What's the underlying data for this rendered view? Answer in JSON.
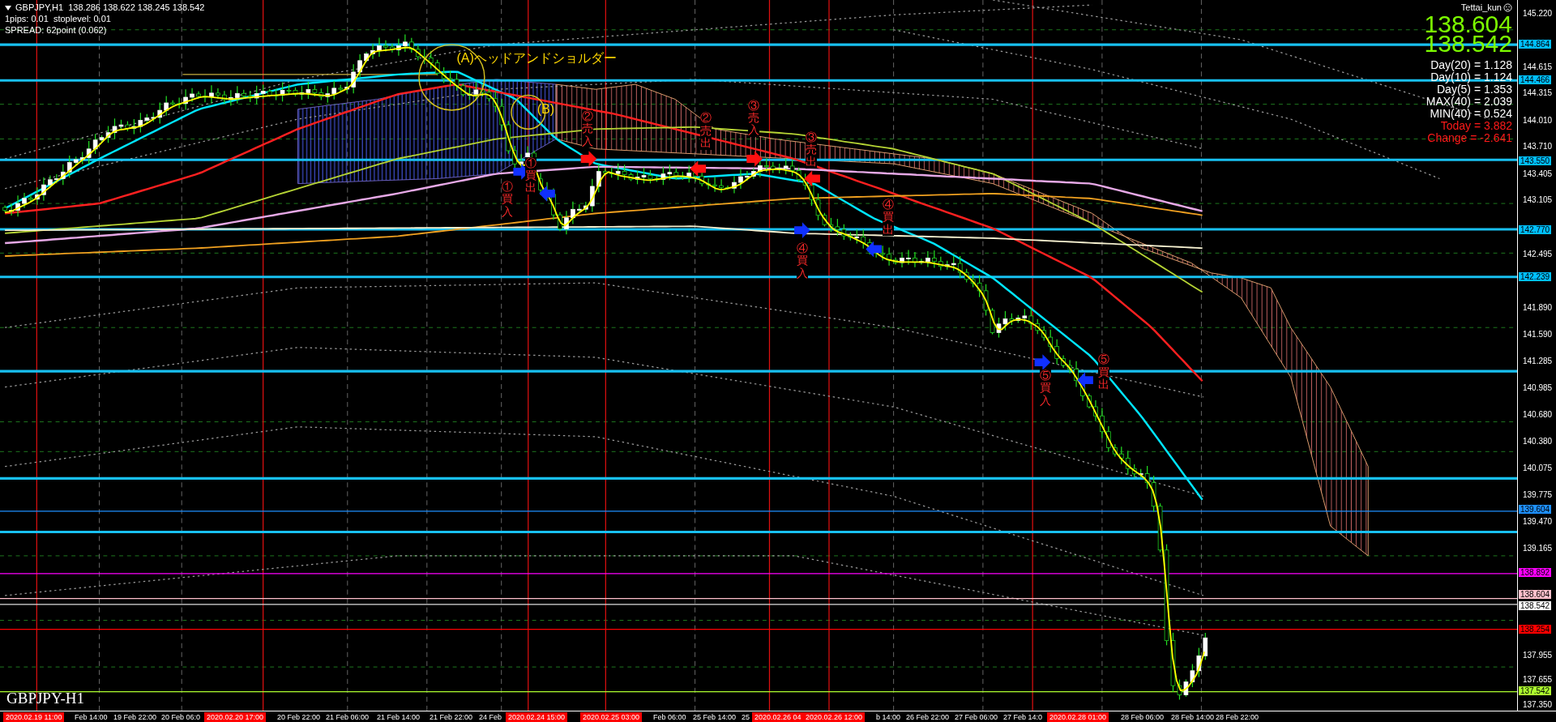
{
  "header": {
    "symbol_line": "GBPJPY,H1  138.286 138.622 138.245 138.542",
    "lines": [
      "1pips: 0.01  stoplevel: 0.01",
      "SPREAD: 62point (0.062)"
    ]
  },
  "info_panel": {
    "user": "Tettai_kun",
    "bid": "138.604",
    "ask": "138.542",
    "stats": [
      {
        "text": "Day(20) = 1.128",
        "kind": "normal"
      },
      {
        "text": "Day(10) = 1.124",
        "kind": "normal"
      },
      {
        "text": "Day(5) = 1.353",
        "kind": "normal"
      },
      {
        "text": "MAX(40) = 2.039",
        "kind": "normal"
      },
      {
        "text": "MIN(40) = 0.524",
        "kind": "normal"
      },
      {
        "text": "Today = 3.882",
        "kind": "alert"
      },
      {
        "text": "Change = -2.641",
        "kind": "alert"
      }
    ]
  },
  "annotations": [
    {
      "text": "(A)ヘッドアンドショルダー",
      "kind": "label"
    },
    {
      "text": "(B)",
      "kind": "label"
    },
    {
      "text": "①買入",
      "kind": "vertical"
    },
    {
      "text": "①買出",
      "kind": "vertical"
    },
    {
      "text": "②売入",
      "kind": "vertical"
    },
    {
      "text": "②売出",
      "kind": "vertical"
    },
    {
      "text": "③売入",
      "kind": "vertical"
    },
    {
      "text": "③売出",
      "kind": "vertical"
    },
    {
      "text": "④買入",
      "kind": "vertical"
    },
    {
      "text": "④買出",
      "kind": "vertical"
    },
    {
      "text": "⑤買入",
      "kind": "vertical"
    },
    {
      "text": "⑤買出",
      "kind": "vertical"
    }
  ],
  "chart_label": "GBPJPY-H1",
  "price_axis": [
    {
      "text": "145.220",
      "kind": "tick"
    },
    {
      "text": "144.864",
      "kind": "tag",
      "color": "#00bfff"
    },
    {
      "text": "144.615",
      "kind": "tick"
    },
    {
      "text": "144.466",
      "kind": "tag",
      "color": "#00bfff"
    },
    {
      "text": "144.315",
      "kind": "tick"
    },
    {
      "text": "144.010",
      "kind": "tick"
    },
    {
      "text": "143.710",
      "kind": "tick"
    },
    {
      "text": "143.550",
      "kind": "tag",
      "color": "#00bfff"
    },
    {
      "text": "143.405",
      "kind": "tick"
    },
    {
      "text": "143.105",
      "kind": "tick"
    },
    {
      "text": "142.770",
      "kind": "tag",
      "color": "#00bfff"
    },
    {
      "text": "142.495",
      "kind": "tick"
    },
    {
      "text": "142.239",
      "kind": "tag",
      "color": "#00bfff"
    },
    {
      "text": "141.890",
      "kind": "tick"
    },
    {
      "text": "141.590",
      "kind": "tick"
    },
    {
      "text": "141.285",
      "kind": "tick"
    },
    {
      "text": "140.985",
      "kind": "tick"
    },
    {
      "text": "140.680",
      "kind": "tick"
    },
    {
      "text": "140.380",
      "kind": "tick"
    },
    {
      "text": "140.075",
      "kind": "tick"
    },
    {
      "text": "139.775",
      "kind": "tick"
    },
    {
      "text": "139.604",
      "kind": "tag",
      "color": "#1e90ff"
    },
    {
      "text": "139.470",
      "kind": "tick"
    },
    {
      "text": "139.165",
      "kind": "tick"
    },
    {
      "text": "138.892",
      "kind": "tag",
      "color": "#ff00ff"
    },
    {
      "text": "138.604",
      "kind": "tag",
      "color": "#ffc0cb"
    },
    {
      "text": "138.542",
      "kind": "tag",
      "color": "#ffffff"
    },
    {
      "text": "138.254",
      "kind": "tag",
      "color": "#ff0000"
    },
    {
      "text": "137.955",
      "kind": "tick"
    },
    {
      "text": "137.655",
      "kind": "tick"
    },
    {
      "text": "137.542",
      "kind": "tag",
      "color": "#adff2f"
    },
    {
      "text": "137.350",
      "kind": "tick"
    }
  ],
  "time_axis": [
    {
      "text": "2020.02.19 11:00",
      "kind": "tag"
    },
    {
      "text": "Feb 14:00",
      "kind": "tick"
    },
    {
      "text": "19 Feb 22:00",
      "kind": "tick"
    },
    {
      "text": "20 Feb 06:0",
      "kind": "tick"
    },
    {
      "text": "2020.02.20 17:00",
      "kind": "tag"
    },
    {
      "text": "20 Feb 22:00",
      "kind": "tick"
    },
    {
      "text": "21 Feb 06:00",
      "kind": "tick"
    },
    {
      "text": "21 Feb 14:00",
      "kind": "tick"
    },
    {
      "text": "21 Feb 22:00",
      "kind": "tick"
    },
    {
      "text": "24 Feb",
      "kind": "tick"
    },
    {
      "text": "2020.02.24 15:00",
      "kind": "tag"
    },
    {
      "text": "2020.02.25 03:00",
      "kind": "tag"
    },
    {
      "text": "Feb 06:00",
      "kind": "tick"
    },
    {
      "text": "25 Feb 14:00",
      "kind": "tick"
    },
    {
      "text": "25",
      "kind": "tick"
    },
    {
      "text": "2020.02.26 04",
      "kind": "tag"
    },
    {
      "text": "2020.02.26 12:00",
      "kind": "tag"
    },
    {
      "text": "b 14:00",
      "kind": "tick"
    },
    {
      "text": "26 Feb 22:00",
      "kind": "tick"
    },
    {
      "text": "27 Feb 06:00",
      "kind": "tick"
    },
    {
      "text": "27 Feb 14:0",
      "kind": "tick"
    },
    {
      "text": "2020.02.28 01:00",
      "kind": "tag"
    },
    {
      "text": "28 Feb 06:00",
      "kind": "tick"
    },
    {
      "text": "28 Feb 14:00",
      "kind": "tick"
    },
    {
      "text": "28 Feb 22:00",
      "kind": "tick"
    }
  ]
}
